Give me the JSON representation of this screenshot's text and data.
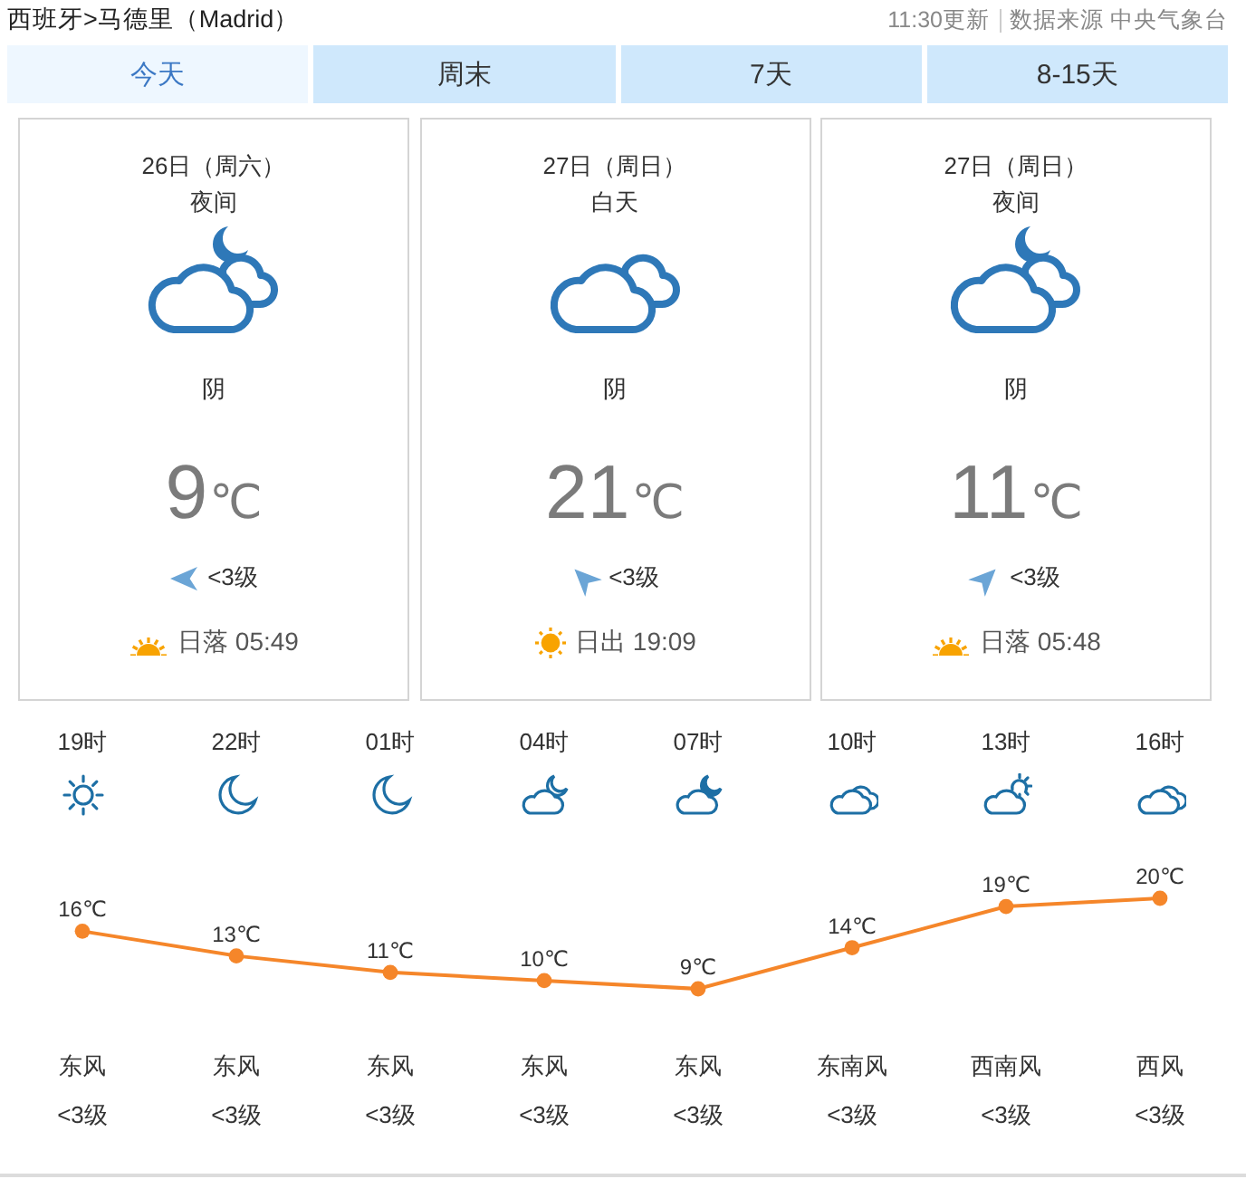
{
  "header": {
    "location": "西班牙>马德里（Madrid）",
    "update_time": "11:30更新",
    "source": "数据来源 中央气象台"
  },
  "tabs": [
    {
      "label": "今天",
      "selected": true
    },
    {
      "label": "周末",
      "selected": false
    },
    {
      "label": "7天",
      "selected": false
    },
    {
      "label": "8-15天",
      "selected": false
    }
  ],
  "cards": [
    {
      "date": "26日（周六）",
      "period": "夜间",
      "kind": "night",
      "condition": "阴",
      "temp": "9",
      "unit": "℃",
      "wind_arrow": {
        "kind": "left"
      },
      "wind": "<3级",
      "sun": {
        "kind": "set",
        "text": "日落 05:49"
      }
    },
    {
      "date": "27日（周日）",
      "period": "白天",
      "kind": "day",
      "condition": "阴",
      "temp": "21",
      "unit": "℃",
      "wind_arrow": {
        "kind": "up-left"
      },
      "wind": "<3级",
      "sun": {
        "kind": "rise",
        "text": "日出 19:09"
      }
    },
    {
      "date": "27日（周日）",
      "period": "夜间",
      "kind": "night",
      "condition": "阴",
      "temp": "11",
      "unit": "℃",
      "wind_arrow": {
        "kind": "up-right"
      },
      "wind": "<3级",
      "sun": {
        "kind": "set",
        "text": "日落 05:48"
      }
    }
  ],
  "hourly": {
    "hours": [
      {
        "time": "19时",
        "kind": "sun",
        "temp_unit": "℃",
        "wind_dir": "东风",
        "wind_level": "<3级"
      },
      {
        "time": "22时",
        "kind": "moon",
        "temp_unit": "℃",
        "wind_dir": "东风",
        "wind_level": "<3级"
      },
      {
        "time": "01时",
        "kind": "moon",
        "temp_unit": "℃",
        "wind_dir": "东风",
        "wind_level": "<3级"
      },
      {
        "time": "04时",
        "kind": "cloud-moon",
        "temp_unit": "℃",
        "wind_dir": "东风",
        "wind_level": "<3级"
      },
      {
        "time": "07时",
        "kind": "cloud-moon",
        "temp_unit": "℃",
        "wind_dir": "东风",
        "wind_level": "<3级"
      },
      {
        "time": "10时",
        "kind": "cloud",
        "temp_unit": "℃",
        "wind_dir": "东南风",
        "wind_level": "<3级"
      },
      {
        "time": "13时",
        "kind": "cloud-sun",
        "temp_unit": "℃",
        "wind_dir": "西南风",
        "wind_level": "<3级"
      },
      {
        "time": "16时",
        "kind": "cloud",
        "temp_unit": "℃",
        "wind_dir": "西风",
        "wind_level": "<3级"
      }
    ],
    "chart_data": {
      "type": "line",
      "series": [
        {
          "color": "#f5862a",
          "marker": "circle",
          "values": [
            16,
            13,
            11,
            10,
            9,
            14,
            19,
            20
          ]
        }
      ],
      "data_labels": true
    }
  }
}
